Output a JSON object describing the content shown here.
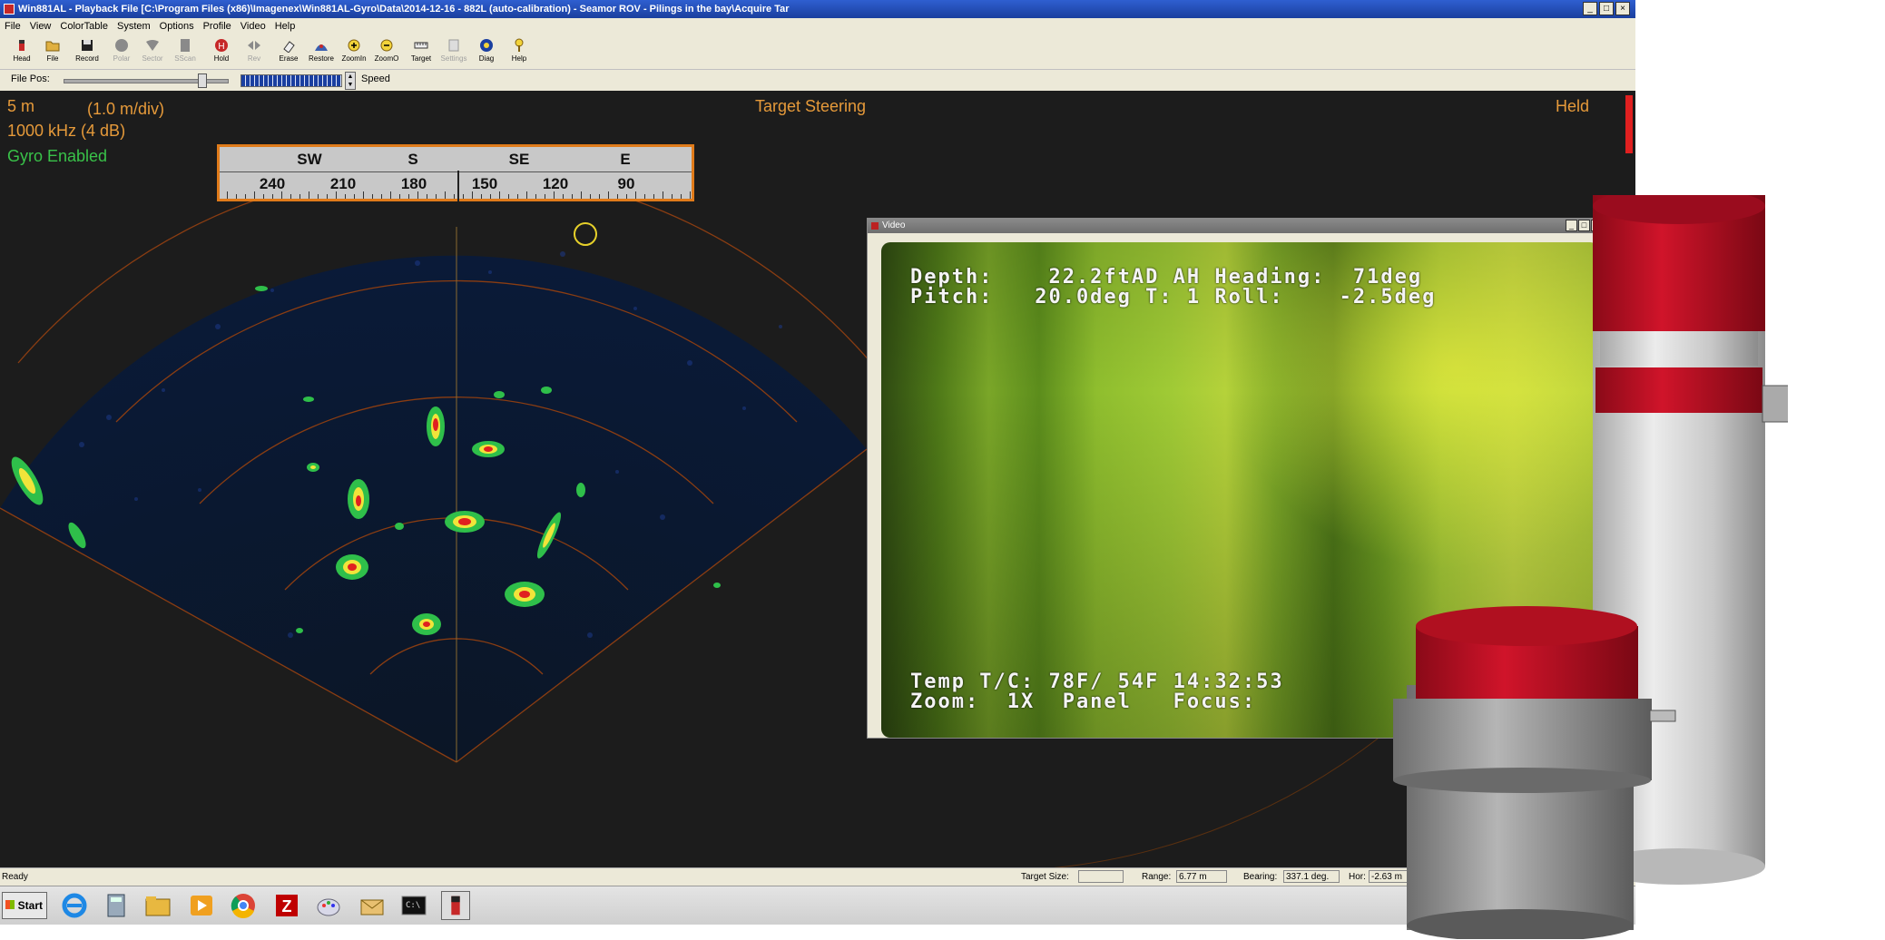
{
  "window": {
    "title": "Win881AL - Playback File [C:\\Program Files (x86)\\Imagenex\\Win881AL-Gyro\\Data\\2014-12-16 - 882L (auto-calibration) - Seamor ROV - Pilings in the bay\\Acquire Tar"
  },
  "menu": [
    "File",
    "View",
    "ColorTable",
    "System",
    "Options",
    "Profile",
    "Video",
    "Help"
  ],
  "toolbar": [
    {
      "label": "Head",
      "icon": "head-icon",
      "enabled": true
    },
    {
      "label": "File",
      "icon": "folder-icon",
      "enabled": true
    },
    {
      "label": "Record",
      "icon": "floppy-icon",
      "enabled": true
    },
    {
      "label": "Polar",
      "icon": "polar-icon",
      "enabled": false
    },
    {
      "label": "Sector",
      "icon": "sector-icon",
      "enabled": false
    },
    {
      "label": "SScan",
      "icon": "sidescan-icon",
      "enabled": false
    },
    {
      "label": "Hold",
      "icon": "hold-icon",
      "enabled": true
    },
    {
      "label": "Rev",
      "icon": "reverse-icon",
      "enabled": false
    },
    {
      "label": "Erase",
      "icon": "eraser-icon",
      "enabled": true
    },
    {
      "label": "Restore",
      "icon": "restore-icon",
      "enabled": true
    },
    {
      "label": "ZoomIn",
      "icon": "zoom-in-icon",
      "enabled": true
    },
    {
      "label": "ZoomO",
      "icon": "zoom-out-icon",
      "enabled": true
    },
    {
      "label": "Target",
      "icon": "target-icon",
      "enabled": true
    },
    {
      "label": "Settings",
      "icon": "settings-icon",
      "enabled": false
    },
    {
      "label": "Diag",
      "icon": "diag-icon",
      "enabled": true
    },
    {
      "label": "Help",
      "icon": "help-icon",
      "enabled": true
    }
  ],
  "filepos": {
    "label": "File Pos:",
    "speed_label": "Speed"
  },
  "sonar": {
    "range": "5 m",
    "division": "(1.0 m/div)",
    "frequency": "1000 kHz (4 dB)",
    "gyro": "Gyro Enabled",
    "mode": "Target Steering",
    "status": "Held",
    "compass": {
      "cardinals": [
        "SW",
        "S",
        "SE",
        "E"
      ],
      "degrees": [
        "240",
        "210",
        "180",
        "150",
        "120",
        "90"
      ]
    },
    "colors": {
      "overlay_orange": "#e69a3a",
      "gyro_green": "#39c249",
      "compass_border": "#e07b1a",
      "status_red": "#e02020"
    }
  },
  "video": {
    "title": "Video",
    "osd_line1": "Depth:    22.2ftAD AH Heading:  71deg",
    "osd_line2": "Pitch:   20.0deg T: 1 Roll:    -2.5deg",
    "osd_line3": "Temp T/C: 78F/ 54F 14:32:53",
    "osd_line4": "Zoom:  1X  Panel   Focus:"
  },
  "statusbar": {
    "ready": "Ready",
    "target_size_label": "Target Size:",
    "target_size_value": "",
    "range_label": "Range:",
    "range_value": "6.77 m",
    "bearing_label": "Bearing:",
    "bearing_value": "337.1 deg.",
    "hor_label": "Hor:",
    "hor_value": "-2.63 m"
  },
  "taskbar": {
    "start_label": "Start",
    "apps": [
      "ie-icon",
      "calculator-icon",
      "file-explorer-icon",
      "media-player-icon",
      "chrome-icon",
      "filezilla-icon",
      "paint-icon",
      "mail-icon",
      "command-prompt-icon",
      "win881al-icon"
    ]
  }
}
